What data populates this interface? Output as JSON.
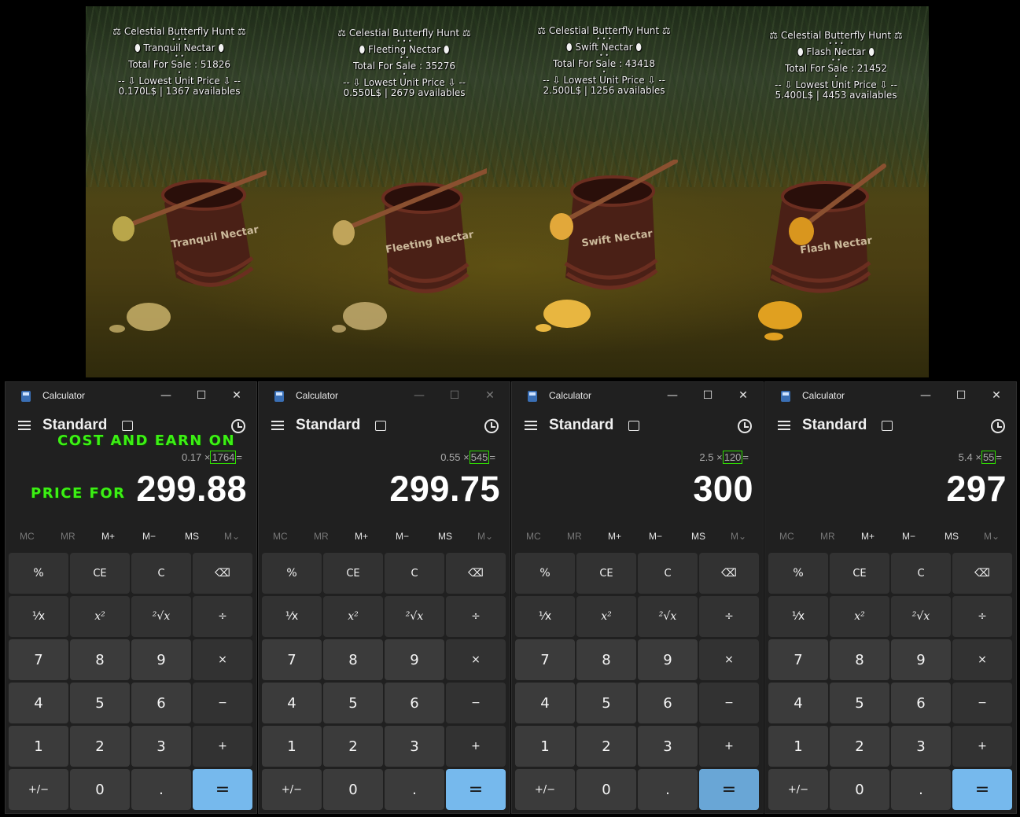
{
  "scene": {
    "signs": [
      {
        "title": "⚖ Celestial Butterfly Hunt ⚖",
        "stars": "• • •",
        "product": "⬮ Tranquil Nectar ⬮",
        "stars2": "• •",
        "total": "Total For Sale : 51826",
        "dot": "•",
        "lowest": "-- ⇩ Lowest Unit Price ⇩ --",
        "price": "0.170L$ | 1367 availables",
        "pot_label": "Tranquil Nectar"
      },
      {
        "title": "⚖ Celestial Butterfly Hunt ⚖",
        "stars": "• • •",
        "product": "⬮ Fleeting Nectar ⬮",
        "stars2": "• •",
        "total": "Total For Sale : 35276",
        "dot": "•",
        "lowest": "-- ⇩ Lowest Unit Price ⇩ --",
        "price": "0.550L$ | 2679 availables",
        "pot_label": "Fleeting Nectar"
      },
      {
        "title": "⚖ Celestial Butterfly Hunt ⚖",
        "stars": "• • •",
        "product": "⬮ Swift Nectar ⬮",
        "stars2": "• •",
        "total": "Total For Sale : 43418",
        "dot": "•",
        "lowest": "-- ⇩ Lowest Unit Price ⇩ --",
        "price": "2.500L$ | 1256 availables",
        "pot_label": "Swift Nectar"
      },
      {
        "title": "⚖ Celestial Butterfly Hunt ⚖",
        "stars": "• • •",
        "product": "⬮ Flash Nectar ⬮",
        "stars2": "• •",
        "total": "Total For Sale : 21452",
        "dot": "•",
        "lowest": "-- ⇩ Lowest Unit Price ⇩ --",
        "price": "5.400L$ | 4453 availables",
        "pot_label": "Flash Nectar"
      }
    ]
  },
  "annotations": {
    "cost_earn": "COST AND EARN ON",
    "price_for": "PRICE FOR"
  },
  "calculators": [
    {
      "app_title": "Calculator",
      "mode": "Standard",
      "expr_left": "0.17 ×",
      "expr_qty": "1764",
      "expr_eq": "=",
      "result": "299.88"
    },
    {
      "app_title": "Calculator",
      "mode": "Standard",
      "expr_left": "0.55 ×",
      "expr_qty": "545",
      "expr_eq": "=",
      "result": "299.75"
    },
    {
      "app_title": "Calculator",
      "mode": "Standard",
      "expr_left": "2.5 ×",
      "expr_qty": "120",
      "expr_eq": "=",
      "result": "300"
    },
    {
      "app_title": "Calculator",
      "mode": "Standard",
      "expr_left": "5.4 ×",
      "expr_qty": "55",
      "expr_eq": "=",
      "result": "297"
    }
  ],
  "window_controls": {
    "minimize": "—",
    "maximize": "☐",
    "close": "✕"
  },
  "memory": {
    "mc": "MC",
    "mr": "MR",
    "mplus": "M+",
    "mminus": "M−",
    "ms": "MS",
    "mview": "M⌄"
  },
  "keys": {
    "percent": "%",
    "ce": "CE",
    "c": "C",
    "backspace": "⌫",
    "reciprocal": "⅟x",
    "square": "x²",
    "sqrt": "²√x",
    "divide": "÷",
    "seven": "7",
    "eight": "8",
    "nine": "9",
    "multiply": "×",
    "four": "4",
    "five": "5",
    "six": "6",
    "minus": "−",
    "one": "1",
    "two": "2",
    "three": "3",
    "plus": "+",
    "negate": "+/−",
    "zero": "0",
    "decimal": ".",
    "equals": "="
  },
  "colors": {
    "annotation_green": "#3cf014",
    "highlight_green": "#2fe000",
    "equals_blue": "#76b9ed",
    "calc_bg": "#202020"
  }
}
